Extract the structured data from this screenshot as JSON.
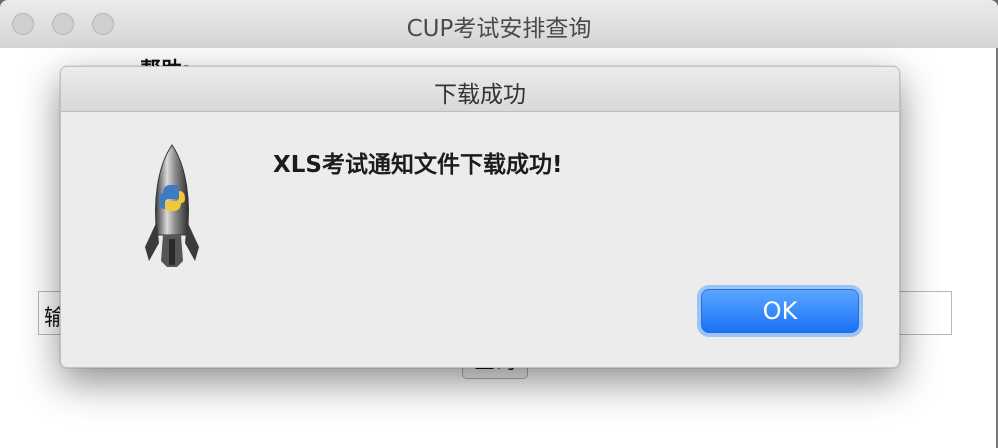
{
  "window": {
    "title": "CUP考试安排查询"
  },
  "content": {
    "help_label": "帮助:",
    "input_label": "输",
    "query_button": "查询"
  },
  "dialog": {
    "title": "下载成功",
    "message": "XLS考试通知文件下载成功!",
    "ok_label": "OK",
    "icon": "python-launcher-rocket-icon"
  },
  "colors": {
    "accent": "#1a72f5",
    "focus_ring": "#9cc4f6",
    "window_bg": "#ececec"
  }
}
